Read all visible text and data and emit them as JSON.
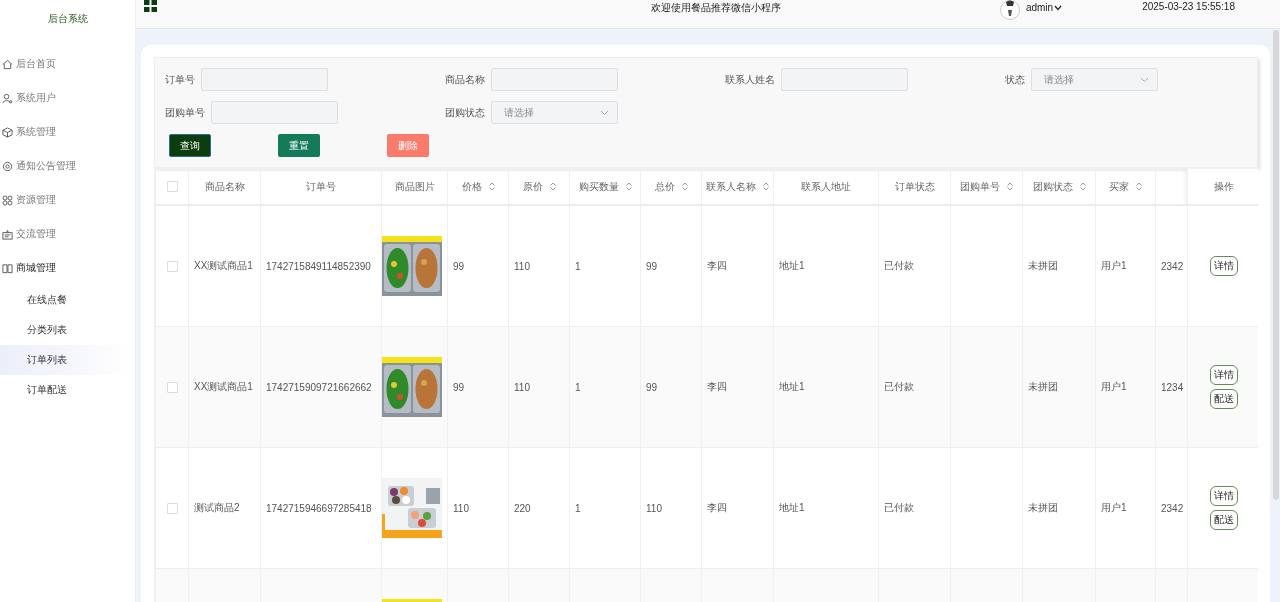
{
  "sidebar": {
    "title": "后台系统",
    "items": [
      {
        "label": "后台首页",
        "expanded": false
      },
      {
        "label": "系统用户",
        "expanded": false
      },
      {
        "label": "系统管理",
        "expanded": false
      },
      {
        "label": "通知公告管理",
        "expanded": false
      },
      {
        "label": "资源管理",
        "expanded": false
      },
      {
        "label": "交流管理",
        "expanded": false
      },
      {
        "label": "商城管理",
        "expanded": true,
        "children": [
          {
            "label": "在线点餐",
            "selected": false
          },
          {
            "label": "分类列表",
            "selected": false
          },
          {
            "label": "订单列表",
            "selected": true
          },
          {
            "label": "订单配送",
            "selected": false
          }
        ]
      }
    ]
  },
  "header": {
    "title": "欢迎使用餐品推荐微信小程序",
    "user": "admin",
    "datetime": "2025-03-23 15:55:18"
  },
  "filters": [
    {
      "kind": "input",
      "label": "订单号"
    },
    {
      "kind": "input",
      "label": "商品名称"
    },
    {
      "kind": "input",
      "label": "联系人姓名"
    },
    {
      "kind": "select",
      "label": "状态",
      "placeholder": "请选择"
    },
    {
      "kind": "input",
      "label": "团购单号"
    },
    {
      "kind": "select",
      "label": "团购状态",
      "placeholder": "请选择"
    }
  ],
  "buttons": [
    {
      "label": "查询",
      "kind": "primary"
    },
    {
      "label": "重置",
      "kind": "secondary"
    },
    {
      "label": "删除",
      "kind": "danger"
    }
  ],
  "table": {
    "all_checked": false,
    "columns": [
      {
        "label": "商品名称",
        "kind": "text",
        "sortable": false
      },
      {
        "label": "订单号",
        "kind": "text",
        "sortable": false
      },
      {
        "label": "商品图片",
        "sortable": false
      },
      {
        "label": "价格",
        "kind": "text",
        "sortable": true
      },
      {
        "label": "原价",
        "kind": "text",
        "sortable": true
      },
      {
        "label": "购买数量",
        "kind": "text",
        "sortable": true
      },
      {
        "label": "总价",
        "kind": "text",
        "sortable": true
      },
      {
        "label": "联系人名称",
        "kind": "text",
        "sortable": true
      },
      {
        "label": "联系人地址",
        "kind": "text",
        "sortable": false
      },
      {
        "label": "订单状态",
        "kind": "text",
        "sortable": false
      },
      {
        "label": "团购单号",
        "kind": "text",
        "sortable": true
      },
      {
        "label": "团购状态",
        "kind": "text",
        "sortable": true
      },
      {
        "label": "买家",
        "kind": "text",
        "sortable": true
      },
      {
        "kind": "text"
      },
      {
        "label": "操作",
        "kind": "actions",
        "sortable": false
      }
    ],
    "rows": [
      {
        "checked": false,
        "cells": [
          "XX测试商品1",
          "1742715849114852390",
          {
            "kind": "picture"
          },
          "99",
          "110",
          "1",
          "99",
          "李四",
          "地址1",
          "已付款",
          null,
          "未拼团",
          "用户1",
          "2342",
          [
            "详情"
          ]
        ]
      },
      {
        "checked": false,
        "cells": [
          "XX测试商品1",
          "1742715909721662662",
          {
            "kind": "picture"
          },
          "99",
          "110",
          "1",
          "99",
          "李四",
          "地址1",
          "已付款",
          null,
          "未拼团",
          "用户1",
          "1234",
          [
            "详情",
            "配送"
          ]
        ]
      },
      {
        "checked": false,
        "cells": [
          "测试商品2",
          "1742715946697285418",
          {
            "kind": "picture"
          },
          "110",
          "220",
          "1",
          "110",
          "李四",
          "地址1",
          "已付款",
          null,
          "未拼团",
          "用户1",
          "2342",
          [
            "详情",
            "配送"
          ]
        ]
      },
      {
        "cells": [
          null,
          null,
          {
            "kind": "picture"
          },
          null,
          null,
          null,
          null,
          null,
          null,
          null,
          null,
          null,
          null,
          null,
          null
        ]
      }
    ]
  }
}
